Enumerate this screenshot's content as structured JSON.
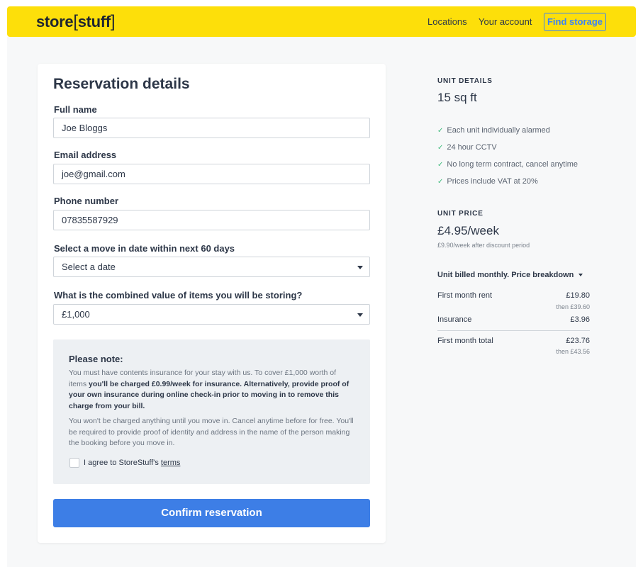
{
  "header": {
    "logo_left": "store",
    "logo_bracket_open": "[",
    "logo_right": "stuff",
    "logo_bracket_close": "]",
    "nav": {
      "locations": "Locations",
      "account": "Your account",
      "find_storage": "Find storage"
    },
    "background_color": "#fddf0a"
  },
  "form": {
    "title": "Reservation details",
    "full_name": {
      "label": "Full name",
      "value": "Joe Bloggs"
    },
    "email": {
      "label": "Email address",
      "value": "joe@gmail.com"
    },
    "phone": {
      "label": "Phone number",
      "value": "07835587929"
    },
    "move_date": {
      "label": "Select a move in date within next 60 days",
      "value": "Select a date"
    },
    "item_value": {
      "label": "What is the combined value of items you will be storing?",
      "value": "£1,000"
    },
    "note": {
      "title": "Please note:",
      "p1_text": "You must have contents insurance for your stay with us. To cover £1,000 worth of items ",
      "p1_bold": "you'll be charged £0.99/week for insurance. Alternatively, provide proof of your own insurance during online check-in prior to moving in to remove this charge from your bill.",
      "p2": "You won't be charged anything until you move in. Cancel anytime before for free. You'll be required to provide proof of identity and address in the name of the person making the booking before you move in.",
      "agree_text": "I agree to StoreStuff's ",
      "agree_link": "terms"
    },
    "confirm_label": "Confirm reservation",
    "confirm_color": "#3d7ee6"
  },
  "unit_details": {
    "title": "UNIT DETAILS",
    "size": "15 sq ft",
    "features": [
      "Each unit individually alarmed",
      "24 hour CCTV",
      "No long term contract, cancel anytime",
      "Prices include VAT at 20%"
    ]
  },
  "unit_price": {
    "title": "UNIT PRICE",
    "price": "£4.95/week",
    "after_discount": "£9.90/week after discount period",
    "breakdown_toggle": "Unit billed monthly. Price breakdown",
    "rows": {
      "rent_label": "First month rent",
      "rent_value": "£19.80",
      "rent_then": "then £39.60",
      "insurance_label": "Insurance",
      "insurance_value": "£3.96",
      "total_label": "First month total",
      "total_value": "£23.76",
      "total_then": "then £43.56"
    }
  }
}
